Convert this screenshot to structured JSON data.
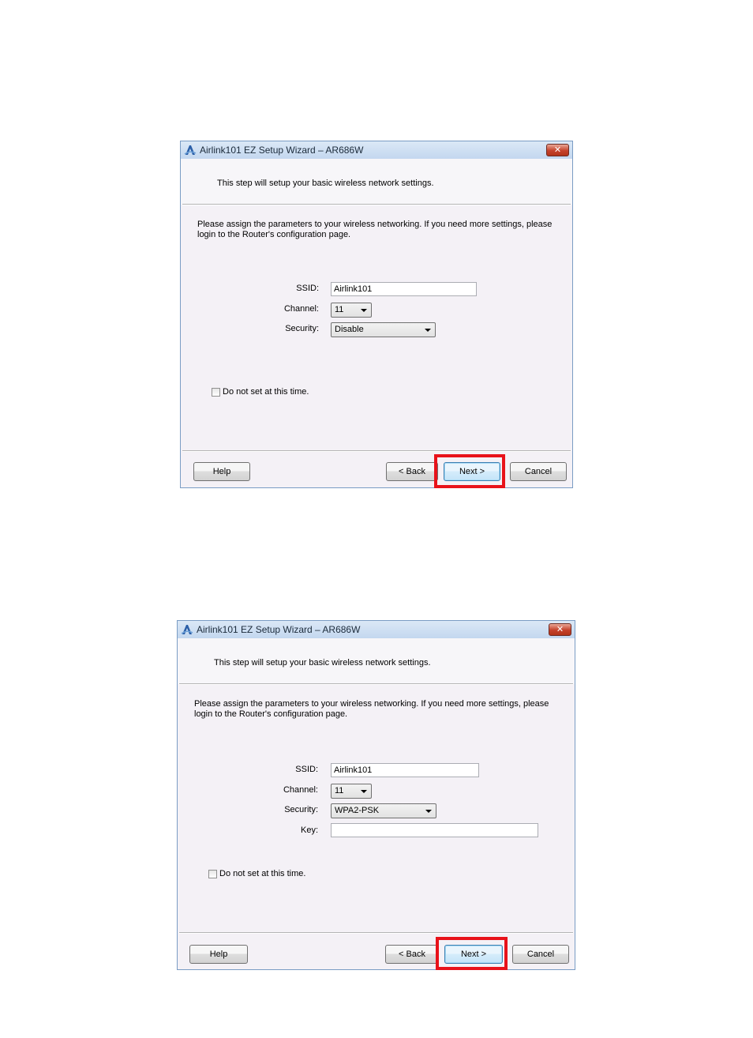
{
  "dialog1": {
    "title": "Airlink101 EZ Setup Wizard – AR686W",
    "close_label": "✕",
    "step_text": "This step will setup your basic wireless network settings.",
    "description": "Please assign the parameters to your wireless networking. If you need more settings, please login to the Router's configuration page.",
    "ssid_label": "SSID:",
    "ssid_value": "Airlink101",
    "channel_label": "Channel:",
    "channel_value": "11",
    "security_label": "Security:",
    "security_value": "Disable",
    "checkbox_label": "Do not set at this time.",
    "help_label": "Help",
    "back_label": "< Back",
    "next_label": "Next >",
    "cancel_label": "Cancel"
  },
  "dialog2": {
    "title": "Airlink101 EZ Setup Wizard – AR686W",
    "close_label": "✕",
    "step_text": "This step will setup your basic wireless network settings.",
    "description": "Please assign the parameters to your wireless networking. If you need more settings, please login to the Router's configuration page.",
    "ssid_label": "SSID:",
    "ssid_value": "Airlink101",
    "channel_label": "Channel:",
    "channel_value": "11",
    "security_label": "Security:",
    "security_value": "WPA2-PSK",
    "key_label": "Key:",
    "key_value": "",
    "checkbox_label": "Do not set at this time.",
    "help_label": "Help",
    "back_label": "< Back",
    "next_label": "Next >",
    "cancel_label": "Cancel"
  },
  "colors": {
    "highlight": "#e8121a",
    "titlebar": "#c3d7ef",
    "dialog_bg": "#f4f1f6"
  }
}
